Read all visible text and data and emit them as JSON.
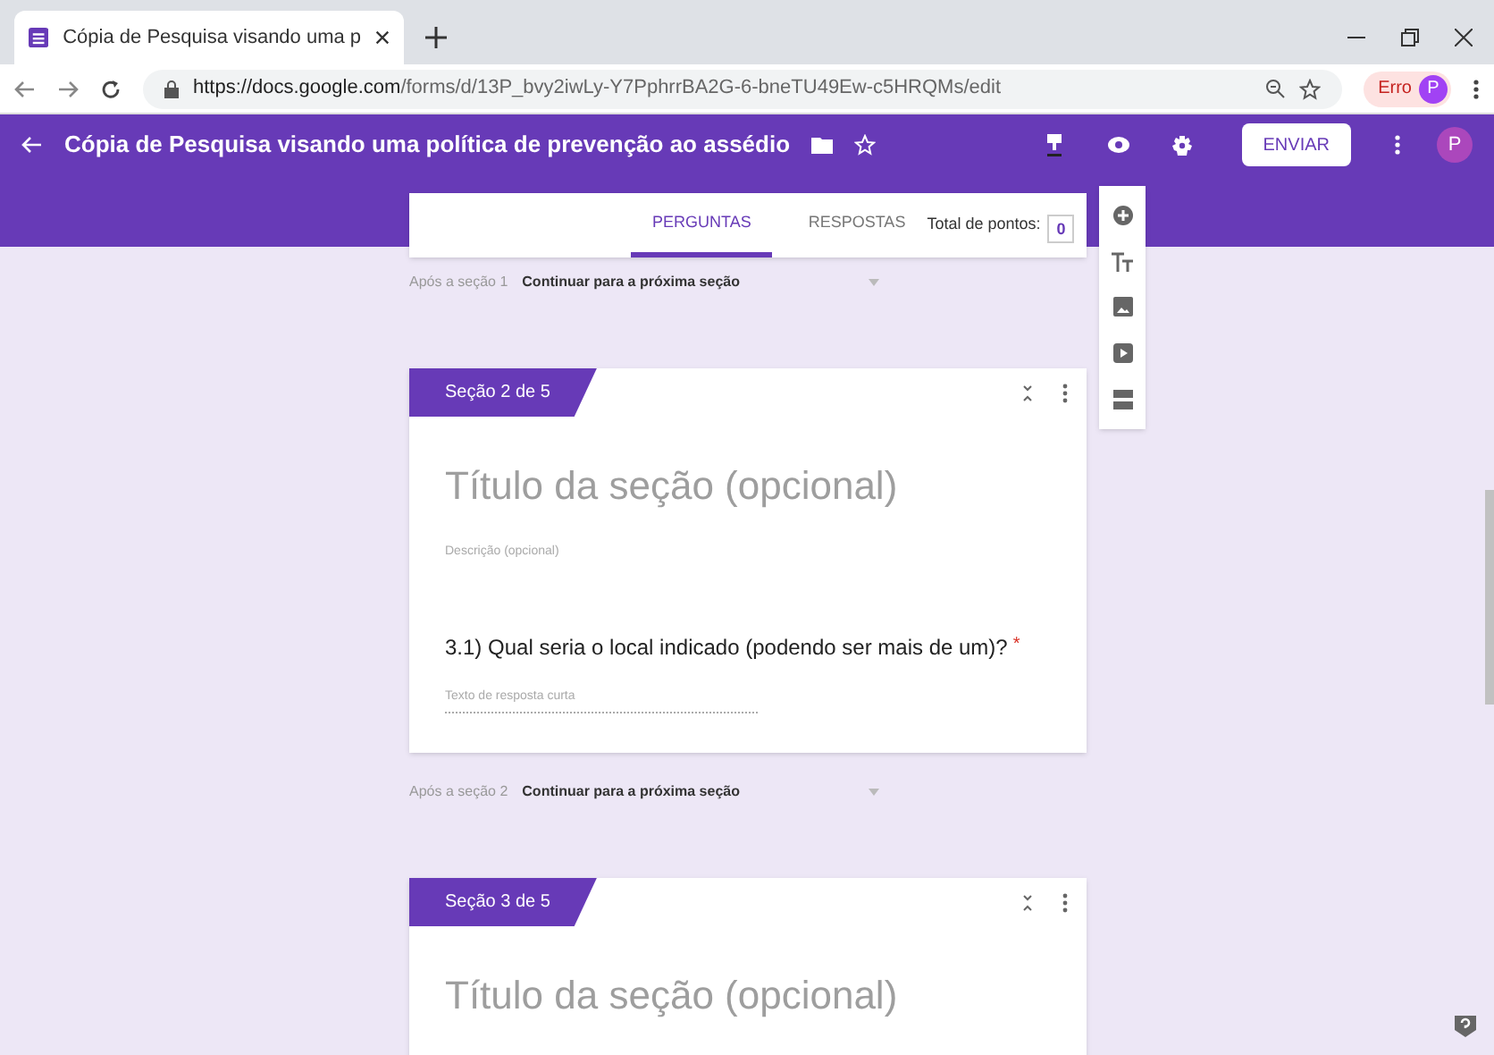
{
  "browser": {
    "tab_title": "Cópia de Pesquisa visando uma p",
    "url_host": "https://docs.google.com",
    "url_path": "/forms/d/13P_bvy2iwLy-Y7PphrrBA2G-6-bneTU49Ew-c5HRQMs/edit",
    "profile_label": "Erro",
    "profile_initial": "P"
  },
  "header": {
    "title": "Cópia de Pesquisa visando uma política de prevenção ao assédio",
    "send_button": "ENVIAR",
    "avatar": "P"
  },
  "tabs": [
    {
      "label": "PERGUNTAS",
      "selected": true
    },
    {
      "label": "RESPOSTAS",
      "selected": false
    }
  ],
  "total_points": {
    "label": "Total de pontos:",
    "value": "0"
  },
  "blocks": [
    {
      "kind": "after",
      "label": "Após a seção 1",
      "action": "Continuar para a próxima seção"
    },
    {
      "kind": "section",
      "tag": "Seção 2 de 5",
      "title_placeholder": "Título da seção (opcional)",
      "description_placeholder": "Descrição (opcional)",
      "questions": [
        {
          "text": "3.1) Qual seria o local indicado (podendo ser mais de um)?",
          "required_mark": "*",
          "answer_placeholder": "Texto de resposta curta"
        }
      ]
    },
    {
      "kind": "after",
      "label": "Após a seção 2",
      "action": "Continuar para a próxima seção"
    },
    {
      "kind": "section",
      "tag": "Seção 3 de 5",
      "title_placeholder": "Título da seção (opcional)"
    }
  ]
}
